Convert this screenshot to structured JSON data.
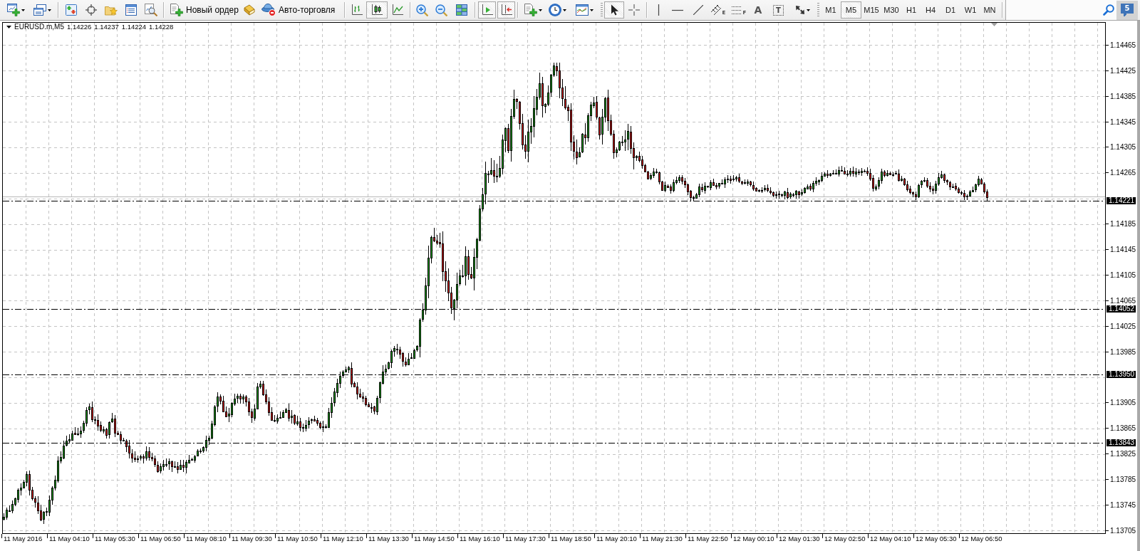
{
  "toolbar": {
    "order_button": {
      "label": "Новый ордер"
    },
    "autotrading_button": {
      "label": "Авто-торговля"
    },
    "chart_types": [
      {
        "selected": false
      },
      {
        "selected": true
      },
      {
        "selected": false
      }
    ],
    "auto_scroll": {
      "on": true
    },
    "chart_shift": {
      "on": true
    },
    "pointer_modes": [
      {
        "selected": true
      },
      {
        "selected": false
      }
    ],
    "object_tools": [
      {
        "kind": "vline"
      },
      {
        "kind": "hline"
      },
      {
        "kind": "trendline"
      },
      {
        "kind": "channel",
        "glyph": "E"
      },
      {
        "kind": "fibo",
        "glyph": "F"
      },
      {
        "kind": "text",
        "glyph": "A"
      },
      {
        "kind": "label",
        "glyph": "T"
      },
      {
        "kind": "arrows"
      }
    ],
    "timeframes": [
      {
        "label": "M1",
        "selected": false
      },
      {
        "label": "M5",
        "selected": true
      },
      {
        "label": "M15",
        "selected": false
      },
      {
        "label": "M30",
        "selected": false
      },
      {
        "label": "H1",
        "selected": false
      },
      {
        "label": "H4",
        "selected": false
      },
      {
        "label": "D1",
        "selected": false
      },
      {
        "label": "W1",
        "selected": false
      },
      {
        "label": "MN",
        "selected": false
      }
    ],
    "messages": {
      "count": "5"
    }
  },
  "chart": {
    "symbol": "EURUSD.m,M5",
    "quotes": [
      "1.14226",
      "1.14237",
      "1.14224",
      "1.14228"
    ],
    "levels": [
      {
        "price": "1.14221"
      },
      {
        "price": "1.14052"
      },
      {
        "price": "1.13950"
      },
      {
        "price": "1.13843"
      }
    ],
    "price_axis": [
      "1.14465",
      "1.14425",
      "1.14385",
      "1.14345",
      "1.14305",
      "1.14265",
      "1.14185",
      "1.14145",
      "1.14105",
      "1.14065",
      "1.14025",
      "1.13985",
      "1.13905",
      "1.13865",
      "1.13825",
      "1.13785",
      "1.13745",
      "1.13705"
    ],
    "time_axis": [
      "11 May 2016",
      "11 May 04:10",
      "11 May 05:30",
      "11 May 06:50",
      "11 May 08:10",
      "11 May 09:30",
      "11 May 10:50",
      "11 May 12:10",
      "11 May 13:30",
      "11 May 14:50",
      "11 May 16:10",
      "11 May 17:30",
      "11 May 18:50",
      "11 May 20:10",
      "11 May 21:30",
      "11 May 22:50",
      "12 May 00:10",
      "12 May 01:30",
      "12 May 02:50",
      "12 May 04:10",
      "12 May 05:30",
      "12 May 06:50"
    ]
  }
}
